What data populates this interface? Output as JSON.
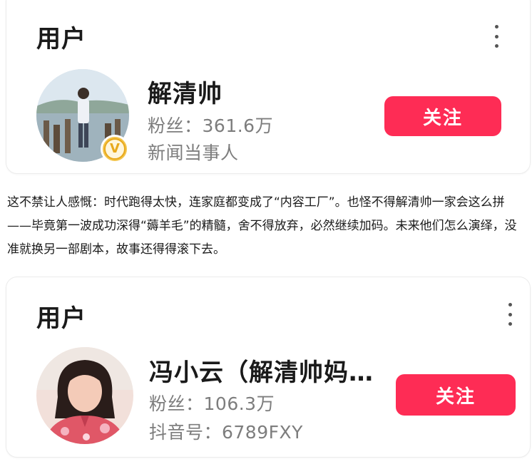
{
  "cards": [
    {
      "heading": "用户",
      "name": "解清帅",
      "followers_label": "粉丝：",
      "followers": "361.6万",
      "subtitle": "新闻当事人",
      "follow_label": "关注",
      "verified_mark": "V"
    },
    {
      "heading": "用户",
      "name": "冯小云（解清帅妈…",
      "followers_label": "粉丝：",
      "followers": "106.3万",
      "subtitle": "抖音号：6789FXY",
      "follow_label": "关注"
    }
  ],
  "paragraph": "这不禁让人感慨：时代跑得太快，连家庭都变成了“内容工厂”。也怪不得解清帅一家会这么拼——毕竟第一波成功深得“薅羊毛”的精髓，舍不得放弃，必然继续加码。未来他们怎么演绎，没准就换另一部剧本，故事还得得滚下去。",
  "colors": {
    "follow_button": "#fe2c55",
    "verified_badge": "#f3c44b"
  }
}
